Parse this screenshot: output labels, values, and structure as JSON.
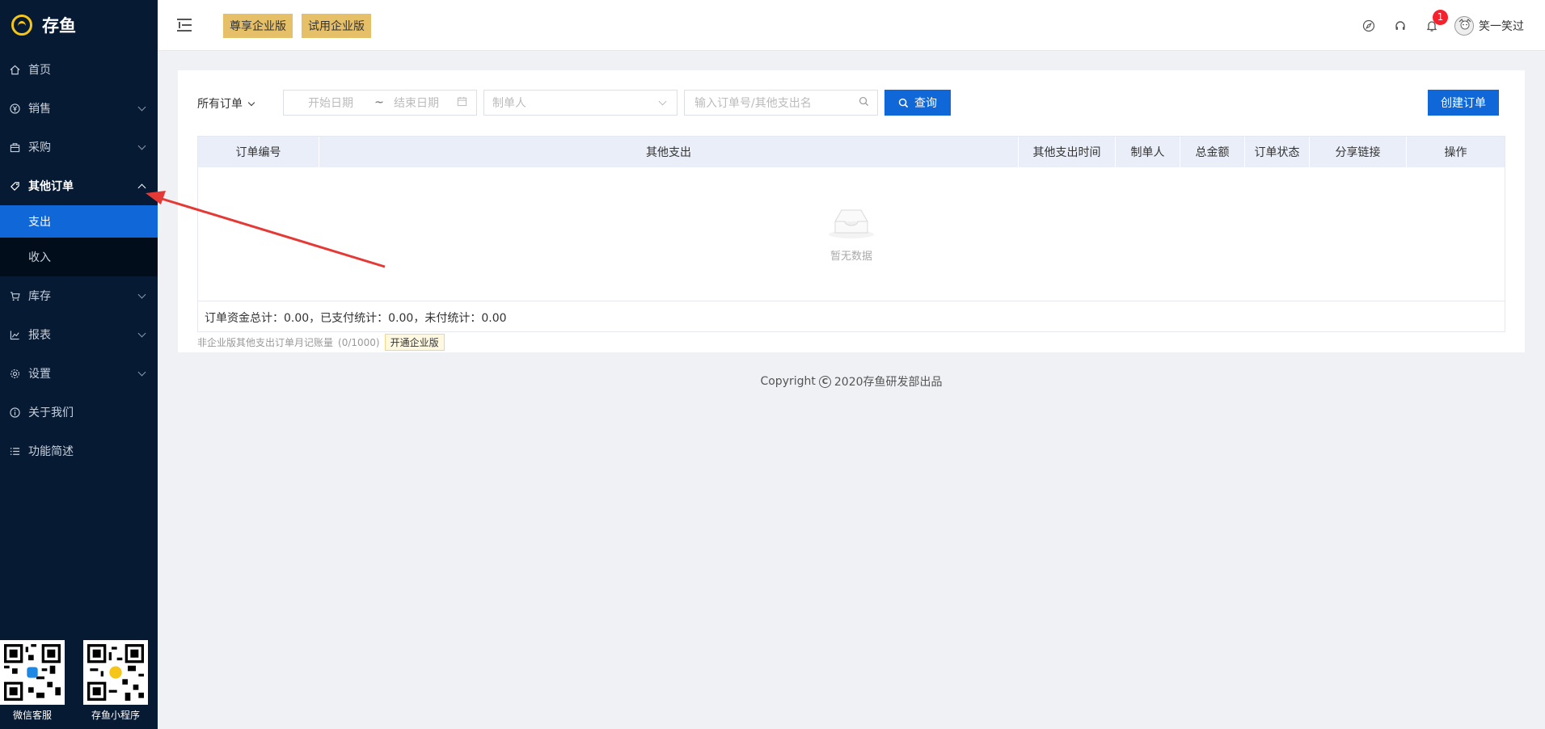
{
  "app": {
    "name": "存鱼"
  },
  "sidebar": {
    "items": [
      {
        "label": "首页",
        "icon": "home-icon"
      },
      {
        "label": "销售",
        "icon": "yen-icon"
      },
      {
        "label": "采购",
        "icon": "bag-icon"
      },
      {
        "label": "其他订单",
        "icon": "tag-icon"
      },
      {
        "label": "库存",
        "icon": "cart-icon"
      },
      {
        "label": "报表",
        "icon": "chart-icon"
      },
      {
        "label": "设置",
        "icon": "gear-icon"
      },
      {
        "label": "关于我们",
        "icon": "info-icon"
      },
      {
        "label": "功能简述",
        "icon": "list-icon"
      }
    ],
    "submenu": [
      {
        "label": "支出",
        "active": true
      },
      {
        "label": "收入",
        "active": false
      }
    ],
    "qr": [
      {
        "label": "微信客服"
      },
      {
        "label": "存鱼小程序"
      }
    ]
  },
  "topbar": {
    "premium_label": "尊享企业版",
    "trial_label": "试用企业版",
    "notification_count": "1",
    "username": "笑一笑过"
  },
  "filters": {
    "all_orders": "所有订单",
    "start_date": "开始日期",
    "range_sep": "~",
    "end_date": "结束日期",
    "maker_placeholder": "制单人",
    "search_placeholder": "输入订单号/其他支出名",
    "query_label": "查询",
    "create_label": "创建订单"
  },
  "table": {
    "columns": [
      "订单编号",
      "其他支出",
      "其他支出时间",
      "制单人",
      "总金额",
      "订单状态",
      "分享链接",
      "操作"
    ],
    "empty_text": "暂无数据",
    "summary": "订单资金总计：0.00，已支付统计：0.00，未付统计：0.00"
  },
  "limit": {
    "text": "非企业版其他支出订单月记账量",
    "count": "(0/1000)",
    "upgrade_label": "开通企业版"
  },
  "footer": {
    "prefix": "Copyright",
    "text": "2020存鱼研发部出品"
  },
  "colors": {
    "sidebar_bg": "#061a33",
    "primary": "#1067d8",
    "gold": "#e6c068",
    "arrow": "#e53935"
  }
}
